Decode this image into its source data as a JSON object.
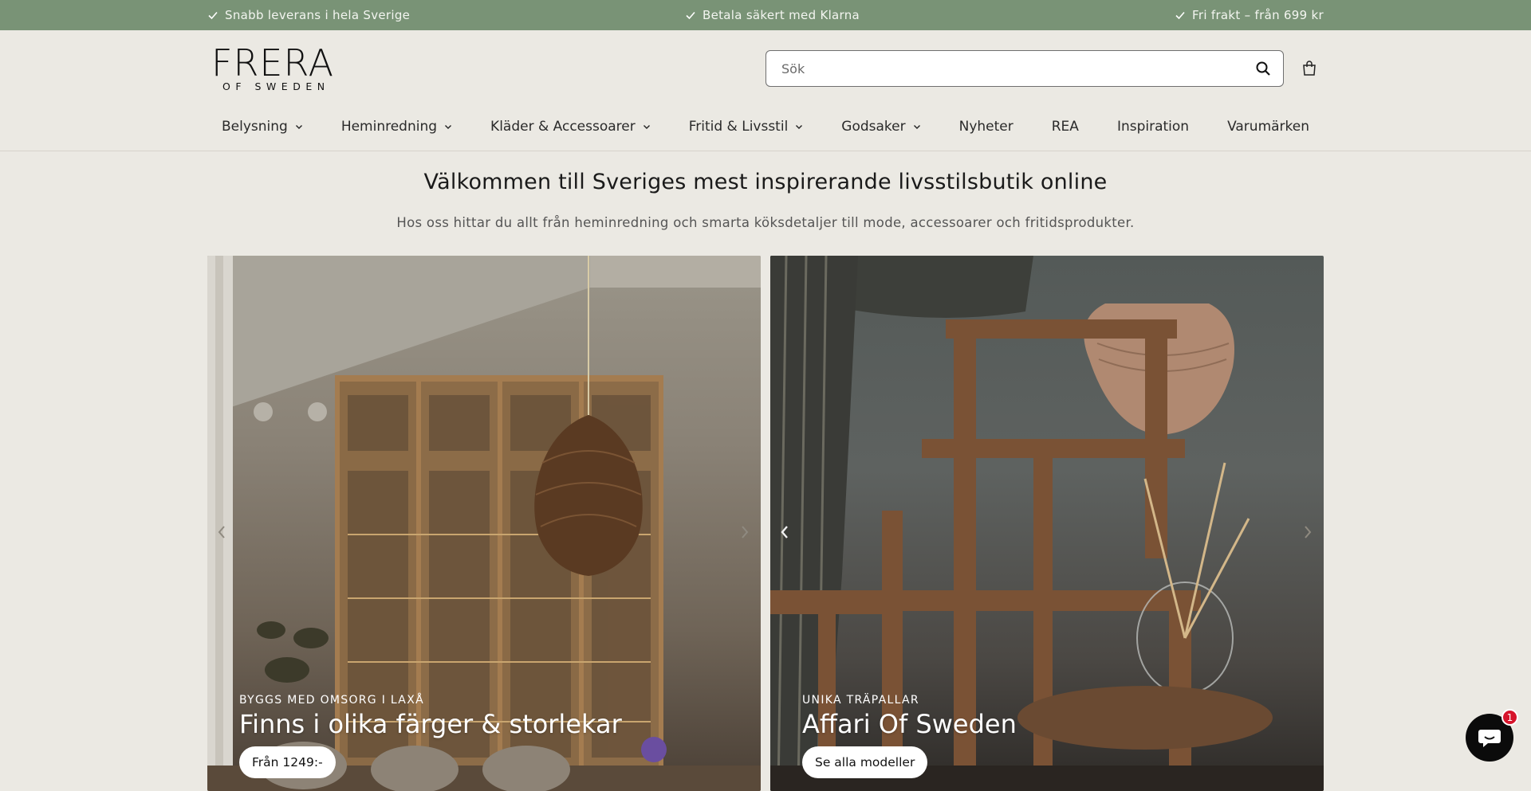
{
  "announcement": {
    "items": [
      "Snabb leverans i hela Sverige",
      "Betala säkert med Klarna",
      "Fri frakt – från 699 kr"
    ]
  },
  "header": {
    "logo_main": "FRERA",
    "logo_sub": "OF SWEDEN",
    "search_placeholder": "Sök",
    "search_icon": "search-icon",
    "cart_icon": "cart-icon"
  },
  "nav": {
    "items": [
      {
        "label": "Belysning",
        "dropdown": true
      },
      {
        "label": "Heminredning",
        "dropdown": true
      },
      {
        "label": "Kläder & Accessoarer",
        "dropdown": true
      },
      {
        "label": "Fritid & Livsstil",
        "dropdown": true
      },
      {
        "label": "Godsaker",
        "dropdown": true
      },
      {
        "label": "Nyheter",
        "dropdown": false
      },
      {
        "label": "REA",
        "dropdown": false
      },
      {
        "label": "Inspiration",
        "dropdown": false
      },
      {
        "label": "Varumärken",
        "dropdown": false
      }
    ]
  },
  "hero": {
    "title": "Välkommen till Sveriges mest inspirerande livsstilsbutik online",
    "subtitle": "Hos oss hittar du allt från heminredning och smarta köksdetaljer till mode, accessoarer och fritidsprodukter."
  },
  "slides": [
    {
      "kicker": "BYGGS MED OMSORG I LAXÅ",
      "headline": "Finns i olika färger & storlekar",
      "cta": "Från 1249:-"
    },
    {
      "kicker": "UNIKA TRÄPALLAR",
      "headline": "Affari Of Sweden",
      "cta": "Se alla modeller"
    }
  ],
  "chat": {
    "badge_count": "1"
  },
  "colors": {
    "announcement_bg": "#799376",
    "page_bg": "#ebe9e3",
    "badge": "#d6142b"
  }
}
